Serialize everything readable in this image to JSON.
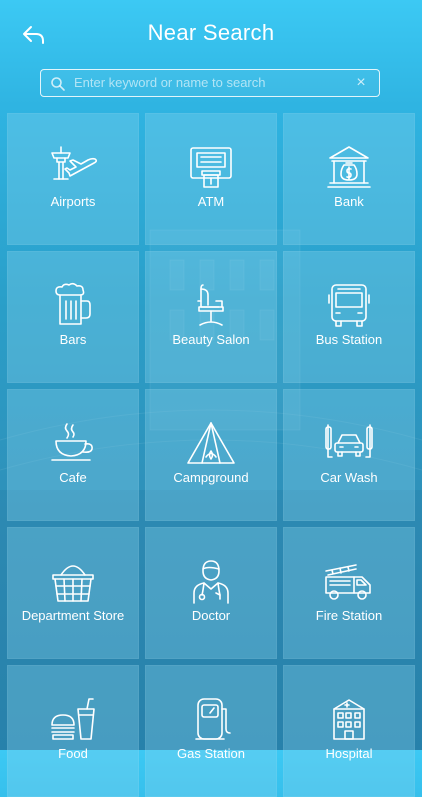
{
  "header": {
    "title": "Near Search",
    "back_icon": "back-arrow-icon"
  },
  "search": {
    "placeholder": "Enter keyword or name to search",
    "value": "",
    "clear_label": "×"
  },
  "categories": [
    {
      "label": "Airports",
      "icon": "airport-icon"
    },
    {
      "label": "ATM",
      "icon": "atm-icon"
    },
    {
      "label": "Bank",
      "icon": "bank-icon"
    },
    {
      "label": "Bars",
      "icon": "beer-mug-icon"
    },
    {
      "label": "Beauty Salon",
      "icon": "salon-chair-icon"
    },
    {
      "label": "Bus Station",
      "icon": "bus-icon"
    },
    {
      "label": "Cafe",
      "icon": "coffee-cup-icon"
    },
    {
      "label": "Campground",
      "icon": "tent-icon"
    },
    {
      "label": "Car Wash",
      "icon": "car-wash-icon"
    },
    {
      "label": "Department Store",
      "icon": "shopping-basket-icon"
    },
    {
      "label": "Doctor",
      "icon": "doctor-icon"
    },
    {
      "label": "Fire Station",
      "icon": "fire-truck-icon"
    },
    {
      "label": "Food",
      "icon": "food-icon"
    },
    {
      "label": "Gas Station",
      "icon": "gas-pump-icon"
    },
    {
      "label": "Hospital",
      "icon": "hospital-icon"
    }
  ],
  "colors": {
    "background_top": "#3cc9f4",
    "background_bottom": "#2a86b0",
    "tile": "#8cd7f0",
    "foreground": "#ffffff"
  }
}
